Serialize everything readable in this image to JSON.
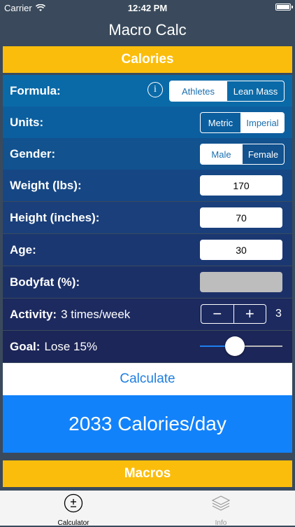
{
  "status": {
    "carrier": "Carrier",
    "time": "12:42 PM"
  },
  "nav": {
    "title": "Macro Calc"
  },
  "calories_section": {
    "title": "Calories"
  },
  "formula": {
    "label": "Formula:",
    "options": [
      "Athletes",
      "Lean Mass"
    ],
    "selected": "Athletes"
  },
  "units": {
    "label": "Units:",
    "options": [
      "Metric",
      "Imperial"
    ],
    "selected": "Imperial"
  },
  "gender": {
    "label": "Gender:",
    "options": [
      "Male",
      "Female"
    ],
    "selected": "Male"
  },
  "weight": {
    "label": "Weight (lbs):",
    "value": "170"
  },
  "height": {
    "label": "Height (inches):",
    "value": "70"
  },
  "age": {
    "label": "Age:",
    "value": "30"
  },
  "bodyfat": {
    "label": "Bodyfat (%):",
    "value": ""
  },
  "activity": {
    "label": "Activity:",
    "text": "3 times/week",
    "minus": "−",
    "plus": "+",
    "value": "3"
  },
  "goal": {
    "label": "Goal:",
    "text": "Lose 15%",
    "slider_fraction": 0.42
  },
  "calculate": {
    "label": "Calculate"
  },
  "result": {
    "text": "2033 Calories/day"
  },
  "macros_section": {
    "title": "Macros"
  },
  "tabs": [
    {
      "label": "Calculator",
      "icon": "plus-minus-icon",
      "active": true
    },
    {
      "label": "Info",
      "icon": "layers-icon",
      "active": false
    }
  ],
  "colors": {
    "header": "#fbbd0c",
    "rows": [
      "#0a6aa8",
      "#0c5f9f",
      "#11528f",
      "#164784",
      "#1a3f7b",
      "#1b3771",
      "#1c3068",
      "#1c2a5f",
      "#1c2658"
    ],
    "calculate_text": "#1e7fe0",
    "result_bg": "#1282fa",
    "slider_fill": "#1e7ff2"
  }
}
